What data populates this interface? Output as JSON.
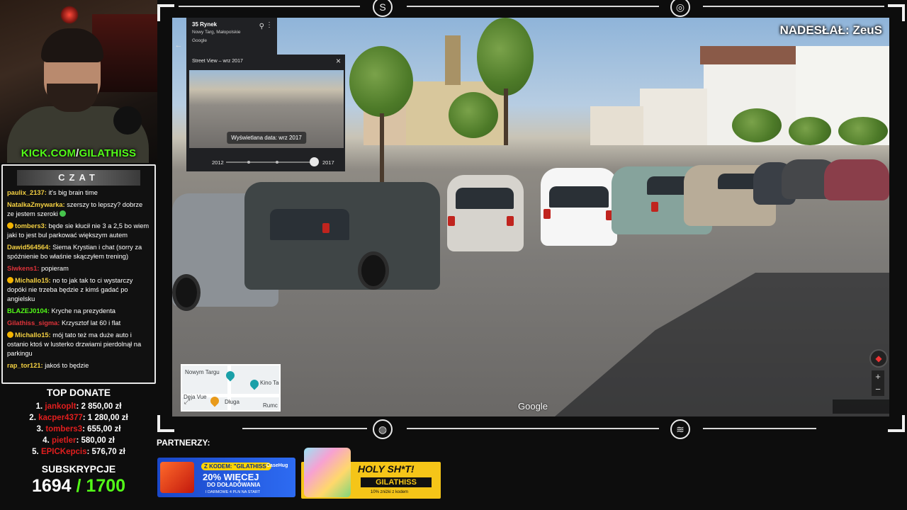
{
  "stream": {
    "kick_url": "KICK.COM/GILATHISS",
    "kick_prefix": "KICK.COM",
    "kick_slash": "/",
    "kick_name": "GILATHISS"
  },
  "chat": {
    "title": "CZAT",
    "messages": [
      {
        "user": "paulix_2137:",
        "text": " it's big brain time",
        "color": "#f5d142"
      },
      {
        "user": "NatalkaZmywarka:",
        "text": " szerszy to lepszy? dobrze ze jestem szeroki ",
        "color": "#f5d142",
        "emote": "green"
      },
      {
        "user": "tombers3:",
        "text": " będe sie kłucił nie 3 a 2,5 bo wiem jaki to jest bul parkować większym autem",
        "color": "#f5d142",
        "emote": "yellow"
      },
      {
        "user": "Dawid564564:",
        "text": " Siema Krystian i chat (sorry za spóźnienie bo właśnie skączyłem trening)",
        "color": "#f5d142"
      },
      {
        "user": "Siwkens1:",
        "text": " popieram",
        "color": "#e0333a"
      },
      {
        "user": "Michallo15:",
        "text": " no to jak tak to ci wystarczy dopóki nie trzeba będzie z kimś gadać po angielsku",
        "color": "#f5d142",
        "emote": "yellow"
      },
      {
        "user": "BLAZEJ0104:",
        "text": " Kryche na prezydenta",
        "color": "#53fc18"
      },
      {
        "user": "Gilathiss_sigma:",
        "text": " Krzysztof lat 60 i flat",
        "color": "#e0333a"
      },
      {
        "user": "Michallo15:",
        "text": " mój tato też ma duże auto i ostanio ktoś w lusterko drzwiami pierdolnął na parkingu",
        "color": "#f5d142",
        "emote": "yellow"
      },
      {
        "user": "rap_tor121:",
        "text": " jakoś to będzie",
        "color": "#f5d142"
      }
    ]
  },
  "top_donate": {
    "title": "TOP DONATE",
    "entries": [
      {
        "rank": "1.",
        "name": "jankoplt",
        "amount": ": 2 850,00 zł"
      },
      {
        "rank": "2.",
        "name": "kacper4377",
        "amount": ": 1 280,00 zł"
      },
      {
        "rank": "3.",
        "name": "tombers3",
        "amount": ": 655,00 zł"
      },
      {
        "rank": "4.",
        "name": "pietler",
        "amount": ": 580,00 zł"
      },
      {
        "rank": "5.",
        "name": "EPICKepcis",
        "amount": ": 576,70 zł"
      }
    ]
  },
  "subs": {
    "title": "SUBSKRYPCJE",
    "current": "1694",
    "goal": "/ 1700"
  },
  "game": {
    "submitted_by": "NADESŁAŁ: ZeuS",
    "google_watermark": "Google",
    "place_card": {
      "title": "35 Rynek",
      "subtitle": "Nowy Targ, Małopolskie",
      "provider": "Google"
    },
    "timeline": {
      "header": "Street View – wrz 2017",
      "tooltip": "Wyświetlana data: wrz 2017",
      "year_start": "2012",
      "year_end": "2017"
    },
    "minimap": {
      "labels": [
        "Nowym Targu",
        "Kino Ta",
        "Deja Vue",
        "Długa",
        "Rumc"
      ]
    },
    "zoom_in": "+",
    "zoom_out": "−"
  },
  "partners": {
    "label": "PARTNERZY:",
    "sponsor1": {
      "code": "Z KODEM: \"GILATHISS\"",
      "brand": "CaseHug",
      "headline": "20% WIĘCEJ",
      "sub": "DO DOŁADOWANIA",
      "fine": "I DARMOWE 4 PLN NA START"
    },
    "sponsor2": {
      "headline": "HOLY SH*T!",
      "code": "GILATHISS",
      "fine": "10% zniżki z kodem"
    }
  },
  "colors": {
    "kick_green": "#53fc18",
    "donate_red": "#e11e1e",
    "frame": "#f0f0f0"
  }
}
